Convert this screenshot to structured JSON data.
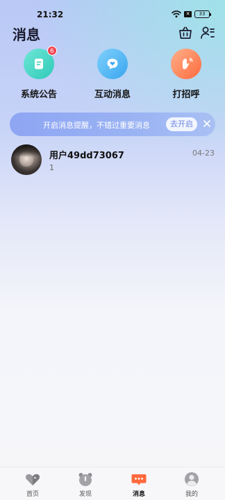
{
  "status_bar": {
    "time": "21:32",
    "sim_label": "✕",
    "battery": "33"
  },
  "header": {
    "title": "消息"
  },
  "quick_entries": [
    {
      "label": "系统公告",
      "badge": "6",
      "icon": "notice-doc-icon",
      "color": "#3ed6c6"
    },
    {
      "label": "互动消息",
      "icon": "heart-chat-icon",
      "color": "#4fb5f5"
    },
    {
      "label": "打招呼",
      "icon": "wave-hand-icon",
      "color": "#ff8a5c"
    }
  ],
  "notice_bar": {
    "text": "开启消息提醒，不错过重要消息",
    "button_label": "去开启"
  },
  "conversations": [
    {
      "name": "用户49dd73067",
      "time": "04-23",
      "preview": "1"
    }
  ],
  "bottom_nav": [
    {
      "label": "首页",
      "icon": "home-heart-icon"
    },
    {
      "label": "发现",
      "icon": "discover-bear-icon"
    },
    {
      "label": "消息",
      "icon": "message-icon",
      "active": true
    },
    {
      "label": "我的",
      "icon": "profile-icon"
    }
  ],
  "colors": {
    "accent": "#ff6a3d",
    "notice_bg": "#9ab3f3",
    "badge": "#f2414f"
  }
}
